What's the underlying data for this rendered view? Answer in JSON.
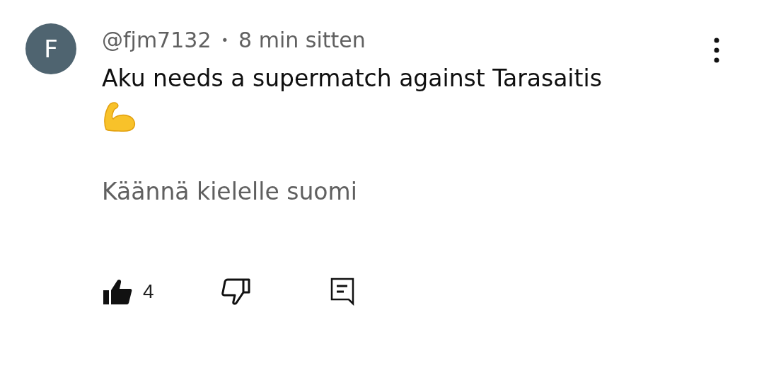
{
  "comment": {
    "avatar_letter": "F",
    "author": "@fjm7132",
    "separator": "•",
    "time": "8 min sitten",
    "text": "Aku needs a supermatch against Tarasaitis",
    "translate_link": "Käännä kielelle suomi",
    "liked": true,
    "disliked": false,
    "like_count": "4"
  }
}
